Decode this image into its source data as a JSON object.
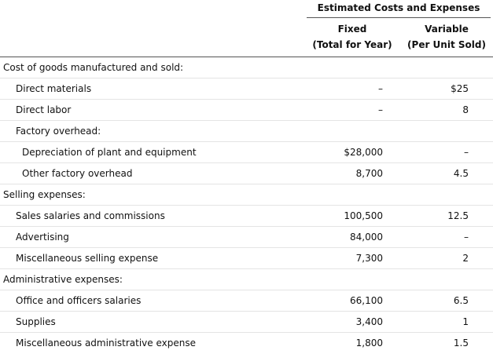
{
  "header": {
    "group_title": "Estimated Costs and Expenses",
    "fixed_line1": "Fixed",
    "fixed_line2": "(Total for Year)",
    "variable_line1": "Variable",
    "variable_line2": "(Per Unit Sold)"
  },
  "rows": [
    {
      "label": "Cost of goods manufactured and sold:",
      "fixed": "",
      "variable": ""
    },
    {
      "label": "Direct materials",
      "fixed": "–",
      "variable": "$25"
    },
    {
      "label": "Direct labor",
      "fixed": "–",
      "variable": "8"
    },
    {
      "label": "Factory overhead:",
      "fixed": "",
      "variable": ""
    },
    {
      "label": "Depreciation of plant and equipment",
      "fixed": "$28,000",
      "variable": "–"
    },
    {
      "label": "Other factory overhead",
      "fixed": "8,700",
      "variable": "4.5"
    },
    {
      "label": "Selling expenses:",
      "fixed": "",
      "variable": ""
    },
    {
      "label": "Sales salaries and commissions",
      "fixed": "100,500",
      "variable": "12.5"
    },
    {
      "label": "Advertising",
      "fixed": "84,000",
      "variable": "–"
    },
    {
      "label": "Miscellaneous selling expense",
      "fixed": "7,300",
      "variable": "2"
    },
    {
      "label": "Administrative expenses:",
      "fixed": "",
      "variable": ""
    },
    {
      "label": "Office and officers salaries",
      "fixed": "66,100",
      "variable": "6.5"
    },
    {
      "label": "Supplies",
      "fixed": "3,400",
      "variable": "1"
    },
    {
      "label": "Miscellaneous administrative expense",
      "fixed": "1,800",
      "variable": "1.5"
    }
  ]
}
